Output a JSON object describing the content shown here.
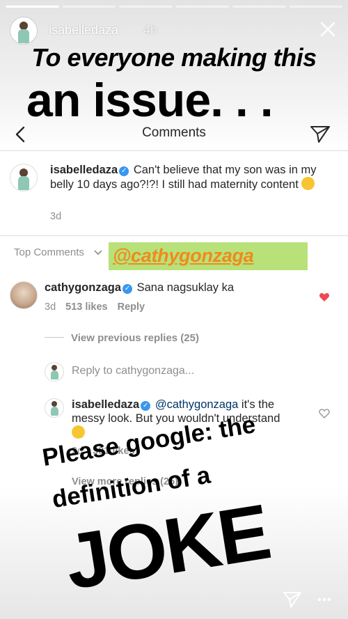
{
  "story": {
    "username": "isabelledaza",
    "time": "4h",
    "caption_line1": "To everyone making this",
    "caption_line2": "an issue. . .",
    "progress_segments": 6,
    "progress_active": 1
  },
  "comments_screen": {
    "title": "Comments",
    "post_caption": {
      "username": "isabelledaza",
      "text": "Can't believe that my son was in my belly 10 days ago?!?! I still had maternity content",
      "age": "3d"
    },
    "top_comments_label": "Top Comments",
    "mention_sticker": "@cathygonzaga",
    "comment": {
      "username": "cathygonzaga",
      "text": "Sana nagsuklay ka",
      "age": "3d",
      "likes": "513 likes",
      "reply_label": "Reply",
      "liked": true
    },
    "view_previous_replies": "View previous replies (25)",
    "reply_placeholder": "Reply to cathygonzaga...",
    "reply": {
      "username": "isabelledaza",
      "mention": "@cathygonzaga",
      "text": "it's the messy look. But you wouldn't understand",
      "age": "2d",
      "likes": "381 likes"
    },
    "view_more_replies": "View more replies (25)"
  },
  "overlay": {
    "line1": "Please google: the",
    "line2": "definition of a",
    "line3": "JOKE"
  },
  "colors": {
    "verified": "#3897f0",
    "heart": "#ed4956",
    "mention_bg": "#b9e179",
    "mention_text": "#f08a1c"
  }
}
